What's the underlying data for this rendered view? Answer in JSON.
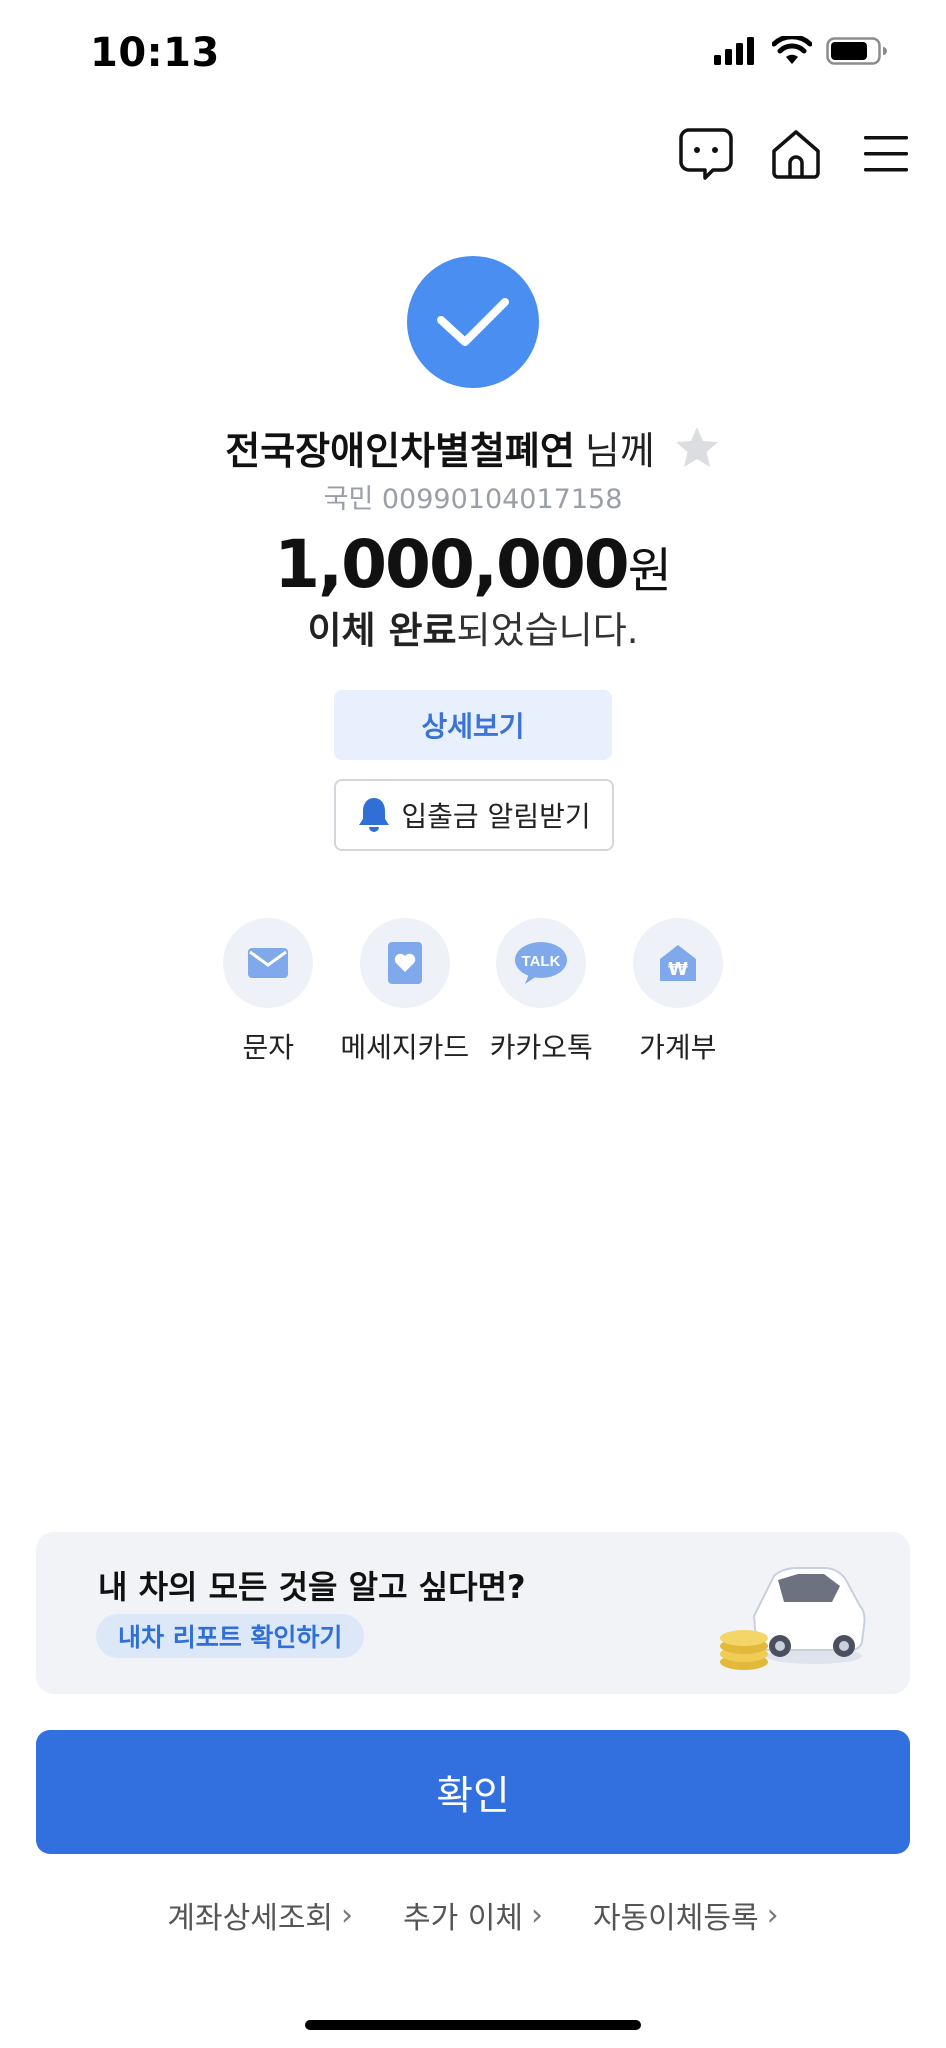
{
  "status_bar": {
    "time": "10:13"
  },
  "nav": {
    "icons": [
      "chat-icon",
      "home-icon",
      "menu-icon"
    ]
  },
  "result": {
    "recipient_name": "전국장애인차별철폐연",
    "recipient_suffix": "님께",
    "account": "국민 00990104017158",
    "amount": "1,000,000",
    "amount_unit": "원",
    "done_bold": "이체 완료",
    "done_rest": "되었습니다."
  },
  "buttons": {
    "detail": "상세보기",
    "alert": "입출금 알림받기",
    "confirm": "확인"
  },
  "share": [
    {
      "label": "문자",
      "icon": "mail-icon"
    },
    {
      "label": "메세지카드",
      "icon": "heart-card-icon"
    },
    {
      "label": "카카오톡",
      "icon": "kakaotalk-icon",
      "icon_text": "TALK"
    },
    {
      "label": "가계부",
      "icon": "won-house-icon",
      "icon_text": "₩"
    }
  ],
  "promo": {
    "title": "내 차의 모든 것을 알고 싶다면?",
    "cta": "내차 리포트 확인하기"
  },
  "bottom_links": [
    {
      "label": "계좌상세조회"
    },
    {
      "label": "추가 이체"
    },
    {
      "label": "자동이체등록"
    }
  ],
  "colors": {
    "accent": "#3370df",
    "check": "#4a8ef2",
    "detail_bg": "#e7f0fc"
  }
}
